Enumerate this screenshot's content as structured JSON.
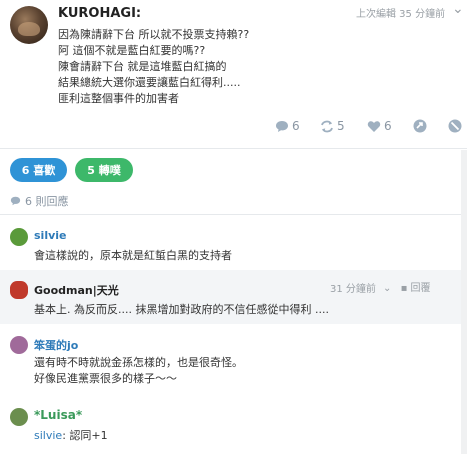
{
  "post": {
    "author": "KUROHAGI:",
    "time": "上次編輯 35 分鐘前",
    "menu": "⌄",
    "lines": [
      "因為陳請辭下台 所以就不投票支持賴??",
      "阿 這個不就是藍白紅要的嗎??",
      "陳會請辭下台 就是這堆藍白紅搞的",
      "結果總統大選你還要讓藍白紅得利.....",
      "匪利這整個事件的加害者"
    ],
    "actions": {
      "comments": "6",
      "reposts": "5",
      "likes": "6"
    }
  },
  "stats": {
    "likes_pill": "6 喜歡",
    "shares_pill": "5 轉噗",
    "reply_count": "6 則回應"
  },
  "comments": [
    {
      "name": "silvie",
      "body": "會這樣說的，原本就是紅蜇白黑的支持者"
    },
    {
      "name": "Goodman|天光",
      "time": "31 分鐘前",
      "reply": "回覆",
      "body": "基本上. 為反而反.... 抹黑增加對政府的不信任感從中得利 ...."
    },
    {
      "name": "笨蛋的jo",
      "lines": [
        "還有時不時就說金孫怎樣的，也是很奇怪。",
        "好像民進黨票很多的樣子～～"
      ]
    },
    {
      "name": "*Luisa*",
      "mention": "silvie",
      "body": ": 認同+1"
    }
  ],
  "colors": {
    "like_pill": "#2f93d6",
    "share_pill": "#3db86a",
    "link_name": "#2d7ab8"
  }
}
